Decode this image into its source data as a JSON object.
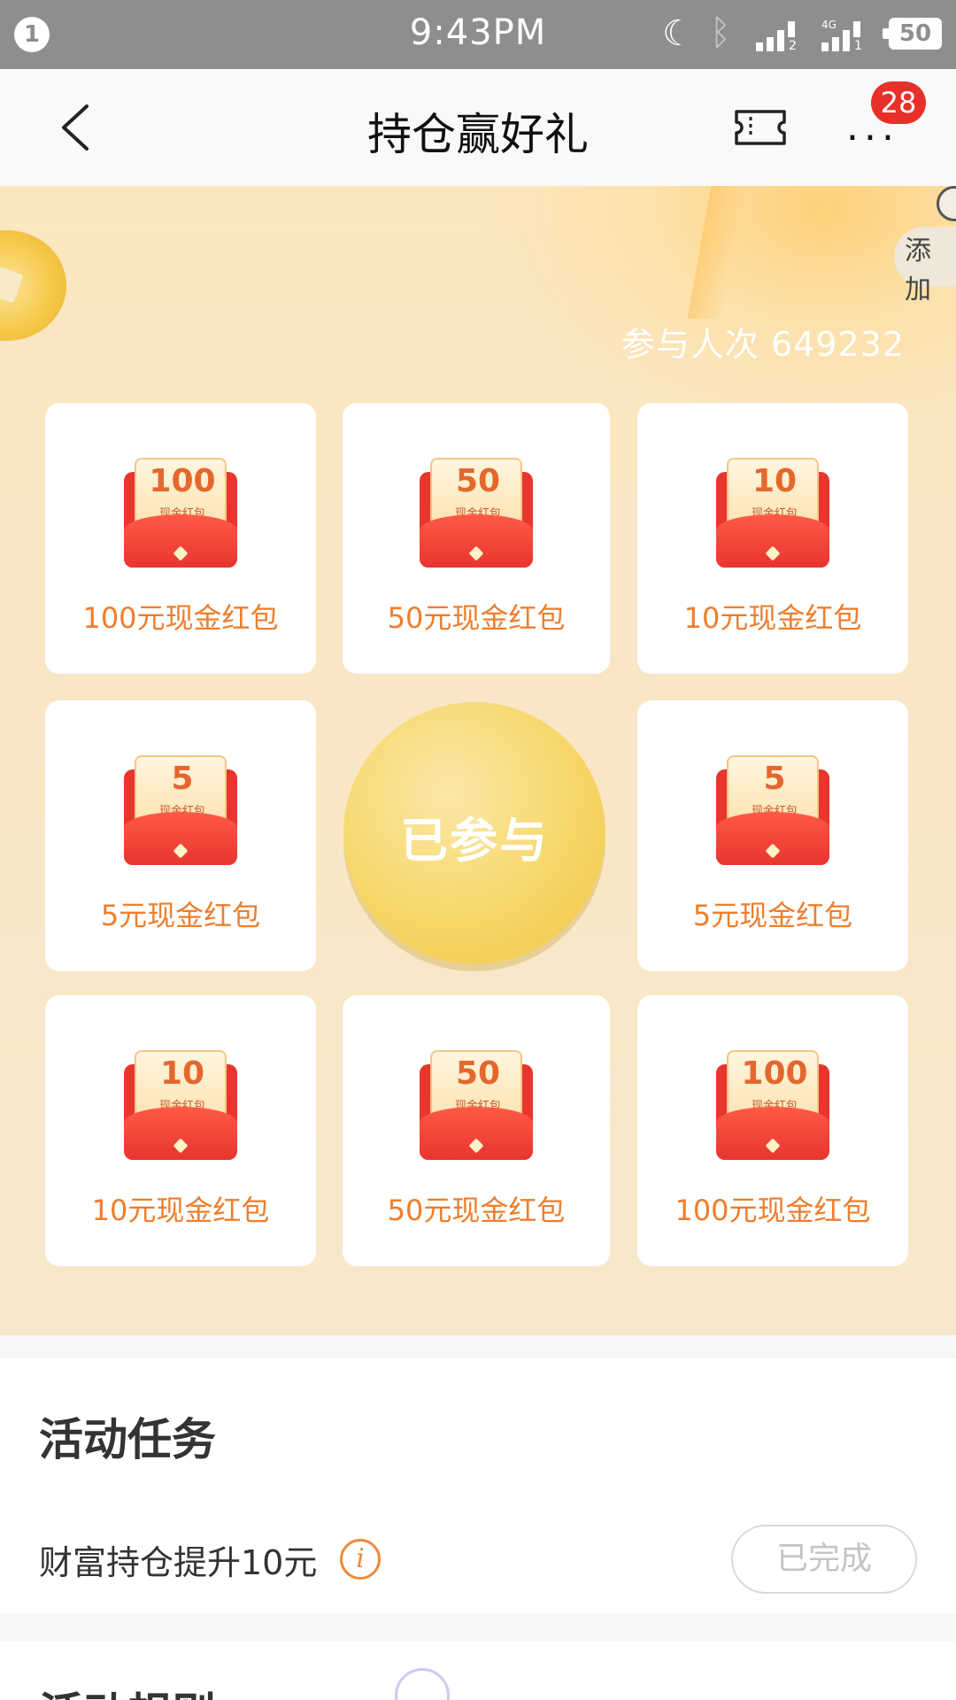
{
  "status_bar": {
    "notification_count": "1",
    "time": "9:43PM",
    "network_type": "4G",
    "battery": "50"
  },
  "nav": {
    "title": "持仓赢好礼",
    "badge_count": "28",
    "more_label": "..."
  },
  "hero": {
    "add_label": "添加",
    "participants": "参与人次 649232"
  },
  "prizes": [
    {
      "amount": "100",
      "envelope_text": "现金红包",
      "label": "100元现金红包"
    },
    {
      "amount": "50",
      "envelope_text": "现金红包",
      "label": "50元现金红包"
    },
    {
      "amount": "10",
      "envelope_text": "现金红包",
      "label": "10元现金红包"
    },
    {
      "amount": "5",
      "envelope_text": "现金红包",
      "label": "5元现金红包"
    },
    {
      "amount": "5",
      "envelope_text": "现金红包",
      "label": "5元现金红包"
    },
    {
      "amount": "10",
      "envelope_text": "现金红包",
      "label": "10元现金红包"
    },
    {
      "amount": "50",
      "envelope_text": "现金红包",
      "label": "50元现金红包"
    },
    {
      "amount": "100",
      "envelope_text": "现金红包",
      "label": "100元现金红包"
    }
  ],
  "join_button": "已参与",
  "tasks": {
    "title": "活动任务",
    "items": [
      {
        "label": "财富持仓提升10元",
        "info_icon": "i",
        "status": "已完成"
      }
    ]
  },
  "rules": {
    "title": "活动规则"
  },
  "colors": {
    "accent_orange": "#ee7e2c",
    "badge_red": "#e8302a",
    "envelope_red": "#e8352e",
    "button_gold": "#f7d769"
  }
}
